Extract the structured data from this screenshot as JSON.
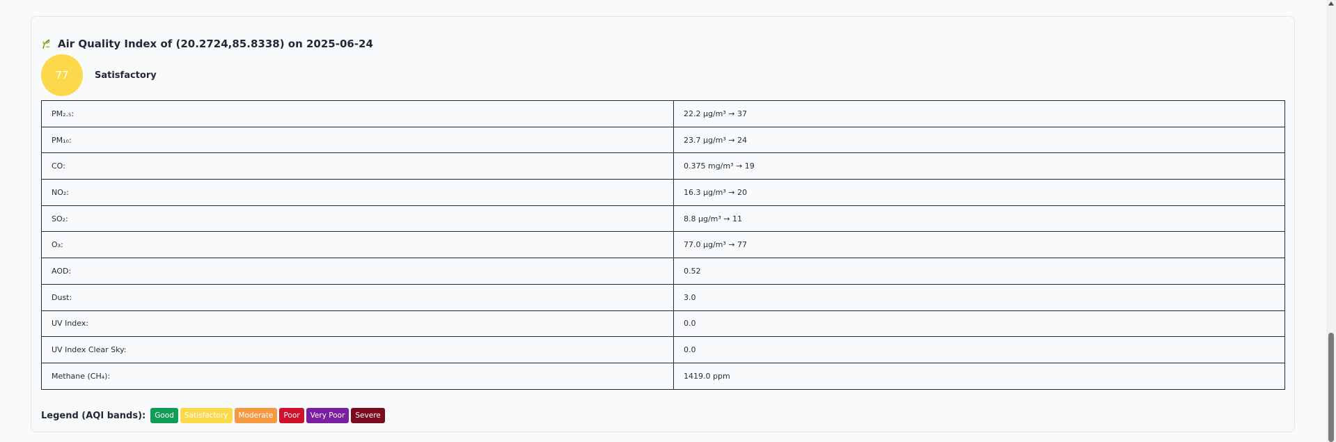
{
  "aqi_panel": {
    "title": "Air Quality Index of (20.2724,85.8338) on 2025-06-24",
    "title_icon": "leaf-icon",
    "aqi_value": "77",
    "aqi_category": "Satisfactory",
    "aqi_color": "#fcd94a"
  },
  "pollutants": [
    {
      "label": "PM₂.₅:",
      "value": "22.2 µg/m³ → 37"
    },
    {
      "label": "PM₁₀:",
      "value": "23.7 µg/m³ → 24"
    },
    {
      "label": "CO:",
      "value": "0.375 mg/m³ → 19"
    },
    {
      "label": "NO₂:",
      "value": "16.3 µg/m³ → 20"
    },
    {
      "label": "SO₂:",
      "value": "8.8 µg/m³ → 11"
    },
    {
      "label": "O₃:",
      "value": "77.0 µg/m³ → 77"
    },
    {
      "label": "AOD:",
      "value": "0.52"
    },
    {
      "label": "Dust:",
      "value": "3.0"
    },
    {
      "label": "UV Index:",
      "value": "0.0"
    },
    {
      "label": "UV Index Clear Sky:",
      "value": "0.0"
    },
    {
      "label": "Methane (CH₄):",
      "value": "1419.0 ppm"
    }
  ],
  "legend": {
    "title": "Legend (AQI bands):",
    "bands": [
      {
        "label": "Good",
        "color": "#0f9d58"
      },
      {
        "label": "Satisfactory",
        "color": "#fcd94a"
      },
      {
        "label": "Moderate",
        "color": "#f59a42"
      },
      {
        "label": "Poor",
        "color": "#d0112b"
      },
      {
        "label": "Very Poor",
        "color": "#7a1fa2"
      },
      {
        "label": "Severe",
        "color": "#7b0c1f"
      }
    ]
  }
}
